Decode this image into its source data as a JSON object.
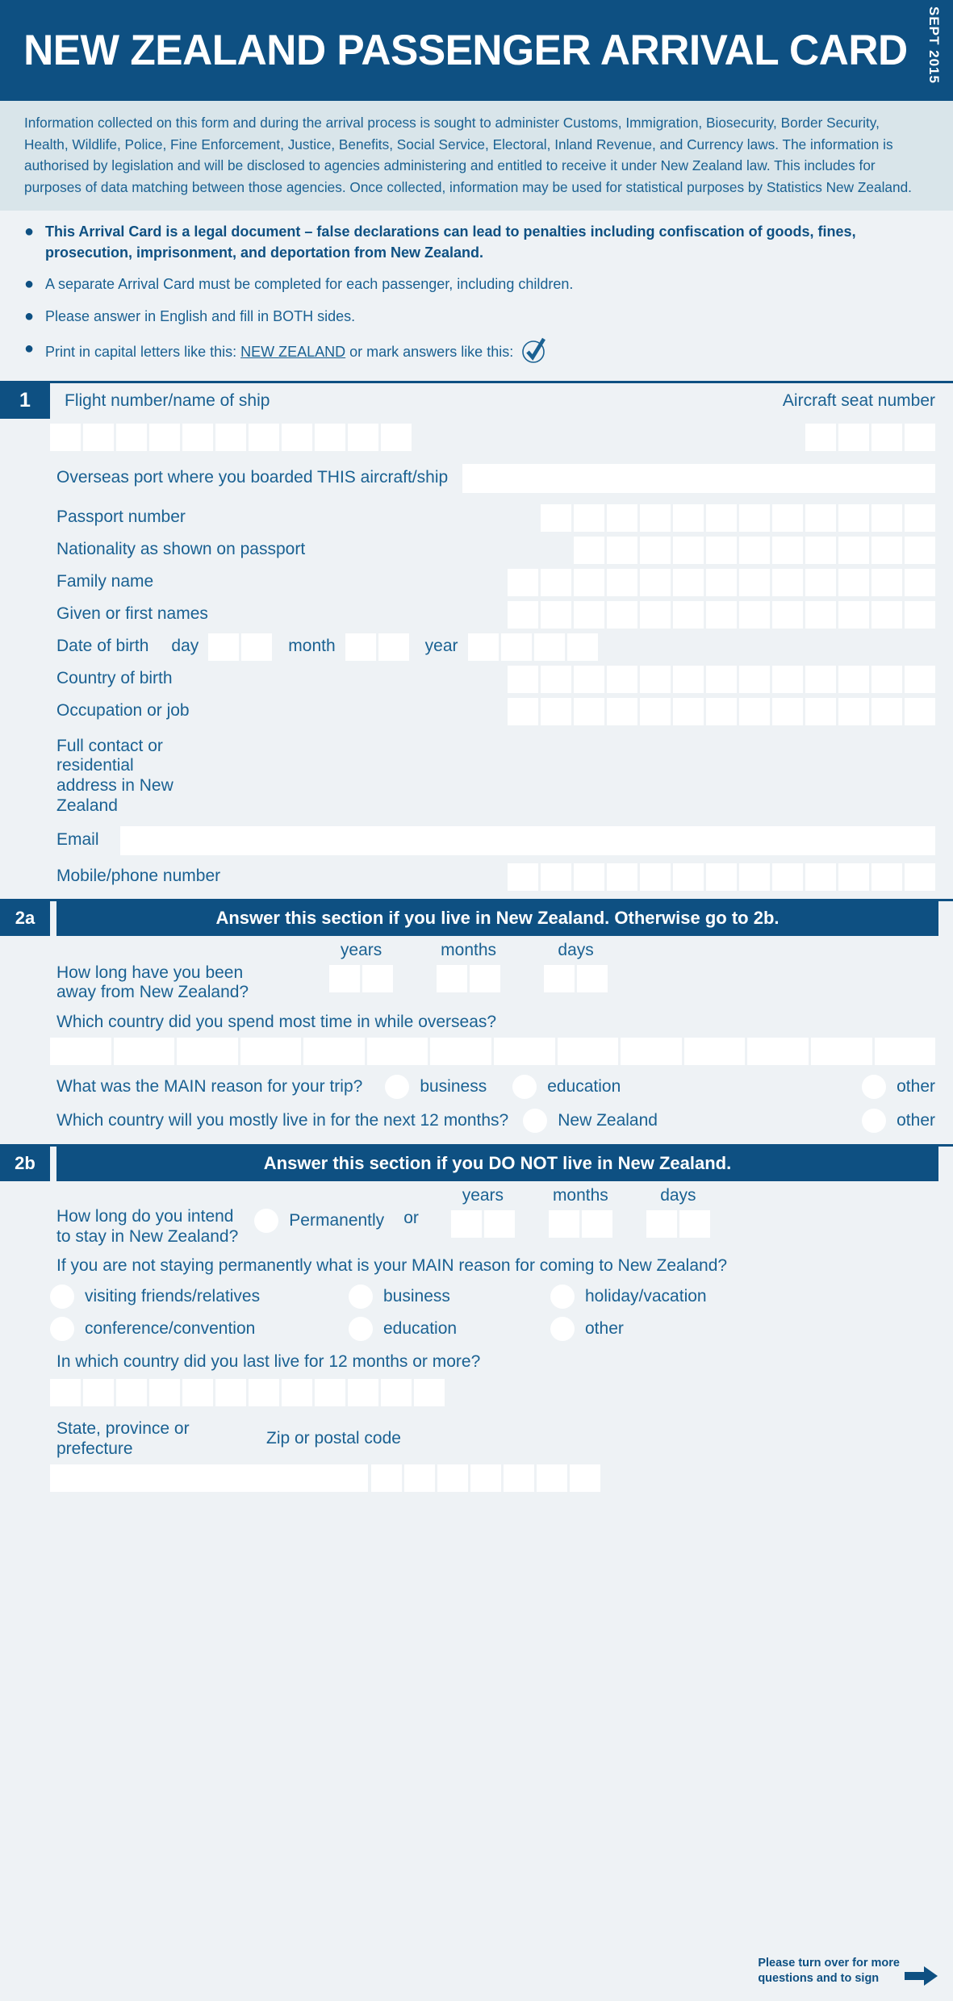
{
  "header": {
    "title": "NEW ZEALAND PASSENGER ARRIVAL CARD",
    "date_stamp": "SEPT 2015",
    "bg_color": "#0e5082",
    "text_color": "#ffffff"
  },
  "privacy": {
    "text": "Information collected on this form and during the arrival process is sought to administer Customs, Immigration, Biosecurity, Border Security, Health, Wildlife, Police, Fine Enforcement, Justice, Benefits, Social Service, Electoral, Inland Revenue, and Currency laws. The information is authorised by legislation and will be disclosed to agencies administering and entitled to receive it under New Zealand law. This includes for purposes of data matching between those agencies. Once collected, information may be used for statistical purposes by Statistics New Zealand."
  },
  "notices": [
    {
      "text": "This Arrival Card is a legal document – false declarations can lead to penalties including confiscation of goods, fines, prosecution, imprisonment, and deportation from New Zealand.",
      "bold": true
    },
    {
      "text": "A separate Arrival Card must be completed for each passenger, including children.",
      "bold": false
    },
    {
      "text": "Please answer in English and fill in BOTH sides.",
      "bold": false
    }
  ],
  "print_notice": {
    "prefix": "Print in capital letters like this:",
    "example": "NEW ZEALAND",
    "middle": "or mark answers like this:",
    "tick_icon": "check-mark-in-circle"
  },
  "section1": {
    "number": "1",
    "flight_label": "Flight number/name of ship",
    "flight_boxes": 11,
    "seat_label": "Aircraft seat number",
    "seat_boxes": 4,
    "overseas_port_label": "Overseas port where you boarded THIS aircraft/ship",
    "fields": [
      {
        "label": "Passport number",
        "boxes": 12
      },
      {
        "label": "Nationality as shown on passport",
        "boxes": 11
      },
      {
        "label": "Family name",
        "boxes": 13
      },
      {
        "label": "Given or first names",
        "boxes": 13
      }
    ],
    "dob": {
      "label": "Date of birth",
      "day_label": "day",
      "day_boxes": 2,
      "month_label": "month",
      "month_boxes": 2,
      "year_label": "year",
      "year_boxes": 4
    },
    "fields2": [
      {
        "label": "Country of birth",
        "boxes": 13
      },
      {
        "label": "Occupation or job",
        "boxes": 13
      }
    ],
    "address": {
      "label_line1": "Full contact or residential",
      "label_line2": "address in New Zealand",
      "lines": 2
    },
    "email_label": "Email",
    "phone_label": "Mobile/phone number",
    "phone_boxes": 13
  },
  "section2a": {
    "number": "2a",
    "banner": "Answer this section if you live in New Zealand. Otherwise go to 2b.",
    "away_question_line1": "How long have you been",
    "away_question_line2": "away from New Zealand?",
    "units": [
      {
        "label": "years",
        "boxes": 2
      },
      {
        "label": "months",
        "boxes": 2
      },
      {
        "label": "days",
        "boxes": 2
      }
    ],
    "most_time_question": "Which country did you spend most time in while overseas?",
    "most_time_boxes": 14,
    "main_reason_question": "What was the MAIN reason for your trip?",
    "main_reason_options": [
      "business",
      "education",
      "other"
    ],
    "live_next_question": "Which country will you mostly live in for the next 12 months?",
    "live_next_options": [
      "New Zealand",
      "other"
    ]
  },
  "section2b": {
    "number": "2b",
    "banner": "Answer this section if you DO NOT live in New Zealand.",
    "stay_question_line1": "How long do you intend",
    "stay_question_line2": "to stay in New Zealand?",
    "permanently_label": "Permanently",
    "or_label": "or",
    "units": [
      {
        "label": "years",
        "boxes": 2
      },
      {
        "label": "months",
        "boxes": 2
      },
      {
        "label": "days",
        "boxes": 2
      }
    ],
    "main_reason_question": "If you are not staying permanently what is your MAIN reason for coming to New Zealand?",
    "reason_options": [
      "visiting friends/relatives",
      "business",
      "holiday/vacation",
      "conference/convention",
      "education",
      "other"
    ],
    "last_live_question": "In which country did you last live for 12 months or more?",
    "last_live_boxes": 12,
    "state_label": "State, province or prefecture",
    "zip_label": "Zip or postal code",
    "zip_boxes": 7
  },
  "footer": {
    "line1": "Please turn over for more",
    "line2": "questions and to sign",
    "arrow_icon": "right-arrow-icon"
  },
  "colors": {
    "brand_blue": "#0e5082",
    "label_blue": "#1a6192",
    "privacy_bg": "#d9e5ea",
    "page_bg": "#eef2f5",
    "field_white": "#ffffff"
  }
}
